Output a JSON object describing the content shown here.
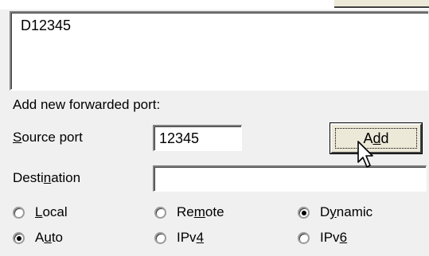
{
  "forward_list": {
    "entries": [
      "D12345"
    ]
  },
  "add_section": {
    "heading": "Add new forwarded port:",
    "source_port_label_pre": "",
    "source_port_label_key": "S",
    "source_port_label_post": "ource port",
    "source_port_value": "12345",
    "destination_label_pre": "Desti",
    "destination_label_key": "n",
    "destination_label_post": "ation",
    "destination_value": "",
    "add_button_pre": "A",
    "add_button_key": "d",
    "add_button_post": "d"
  },
  "radios": {
    "local": {
      "pre": "",
      "key": "L",
      "post": "ocal",
      "checked": false
    },
    "remote": {
      "pre": "Re",
      "key": "m",
      "post": "ote",
      "checked": false
    },
    "dynamic": {
      "pre": "D",
      "key": "y",
      "post": "namic",
      "checked": true
    },
    "auto": {
      "pre": "A",
      "key": "u",
      "post": "to",
      "checked": true
    },
    "ipv4": {
      "pre": "IPv",
      "key": "4",
      "post": "",
      "checked": false
    },
    "ipv6": {
      "pre": "IPv",
      "key": "6",
      "post": "",
      "checked": false
    }
  },
  "icons": {
    "cursor": "arrow-pointer-icon"
  },
  "colors": {
    "panel": "#f0f0f0",
    "field": "#ffffff",
    "shadow": "#808080"
  }
}
